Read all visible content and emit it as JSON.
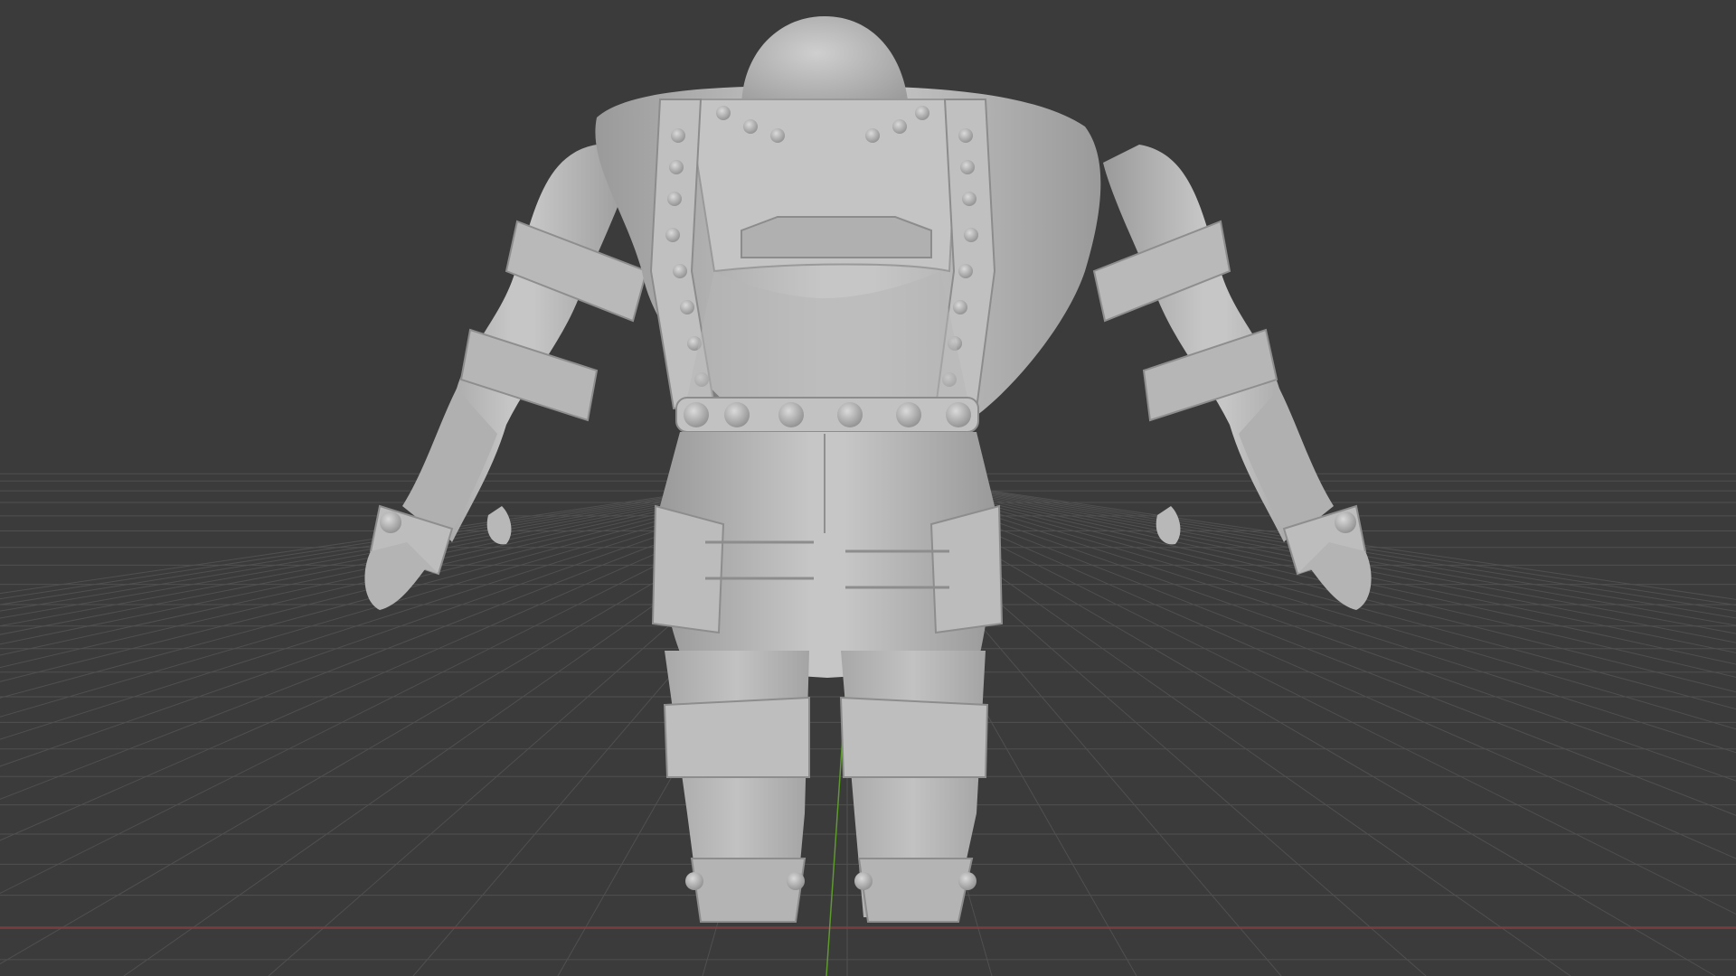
{
  "app": {
    "name": "",
    "view": "3D viewport",
    "shading": "solid",
    "model_view": "back"
  },
  "viewport": {
    "background": "#3b3b3b",
    "grid_color": "#525252",
    "x_axis_color": "#8a3a3a",
    "y_axis_color": "#5e9a2e",
    "model_base_color": "#bcbcbc",
    "model_shadow_color": "#8f8f8f",
    "model_highlight_color": "#d2d2d2"
  }
}
